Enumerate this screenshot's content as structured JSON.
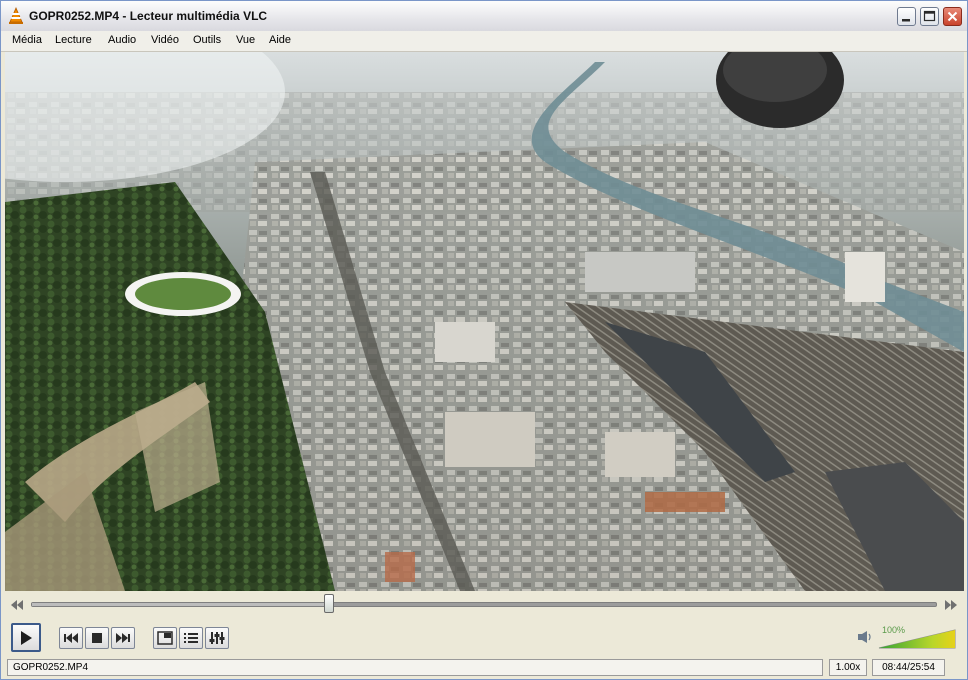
{
  "window": {
    "title": "GOPR0252.MP4 - Lecteur multimédia VLC",
    "buttons": [
      "minimize",
      "maximize",
      "close"
    ]
  },
  "menu": {
    "items": [
      "Média",
      "Lecture",
      "Audio",
      "Vidéo",
      "Outils",
      "Vue",
      "Aide"
    ]
  },
  "playback": {
    "progress_fraction": 0.33,
    "volume_fraction": 1.0,
    "volume_label": "100%"
  },
  "status": {
    "filename": "GOPR0252.MP4",
    "speed": "1.00x",
    "time": "08:44/25:54"
  },
  "icons": {
    "seek_back": "double-left-arrow-icon",
    "seek_forward": "double-right-arrow-icon",
    "play": "play-icon",
    "previous": "previous-track-icon",
    "stop": "stop-icon",
    "next": "next-track-icon",
    "fullscreen": "fullscreen-icon",
    "playlist": "playlist-icon",
    "extended": "equalizer-icon",
    "speaker": "speaker-icon"
  },
  "colors": {
    "accent": "#1d5fb8",
    "volume_green": "#34a334",
    "volume_yellow": "#e6d21a"
  }
}
